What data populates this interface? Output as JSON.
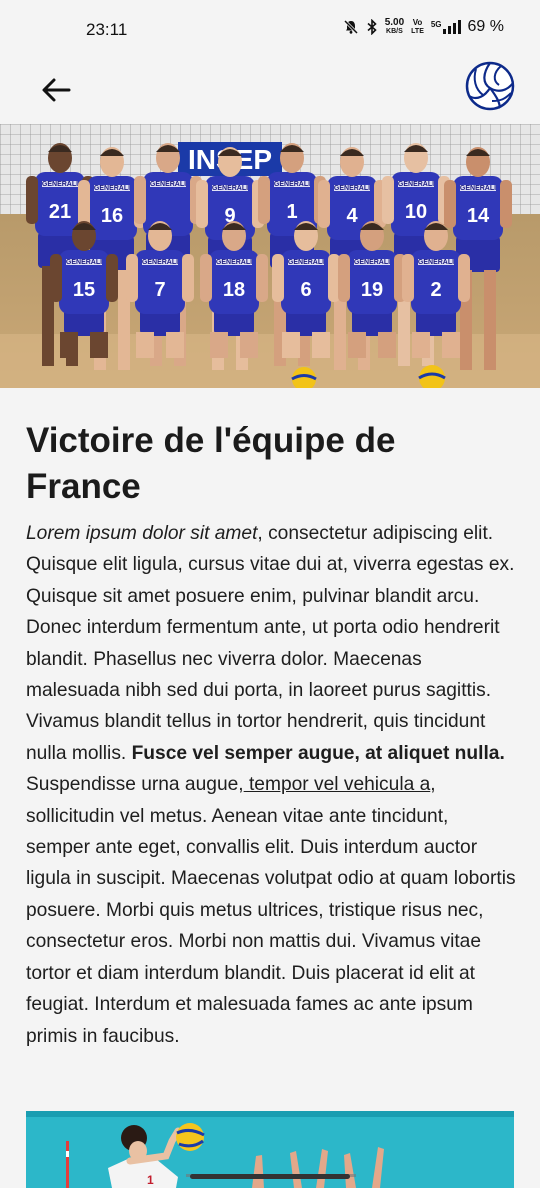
{
  "status_bar": {
    "time": "23:11",
    "net_speed_value": "5.00",
    "net_speed_unit": "KB/S",
    "volte_top": "Vo",
    "volte_bottom": "LTE",
    "network": "5G",
    "battery": "69 %"
  },
  "app_bar": {
    "back_icon": "arrow-left-icon",
    "logo_icon": "volleyball-icon"
  },
  "hero": {
    "image": "team-photo",
    "banner_text": "INSEP",
    "jersey_brand": "GENERALI",
    "back_row_numbers": [
      "21",
      "16",
      "",
      "9",
      "1",
      "4",
      "10",
      "14"
    ],
    "front_row_numbers": [
      "15",
      "7",
      "18",
      "6",
      "19",
      "2"
    ]
  },
  "article": {
    "title": "Victoire de l'équipe de France",
    "p_italic": "Lorem ipsum dolor sit amet",
    "p_part1": ", consectetur adipiscing elit. Quisque elit ligula, cursus vitae dui at, viverra egestas ex. Quisque sit amet posuere enim, pulvinar blandit arcu. Donec interdum fermentum ante, ut porta odio hendrerit blandit. Phasellus nec viverra dolor. Maecenas malesuada nibh sed dui porta, in laoreet purus sagittis. Vivamus blandit tellus in tortor hendrerit, quis tincidunt nulla mollis. ",
    "p_bold": "Fusce vel semper augue, at aliquet nulla.",
    "p_part2": " Suspendisse urna augue,",
    "p_link": " tempor vel vehicula a",
    "p_part3": ", sollicitudin vel metus. Aenean vitae ante tincidunt, semper ante eget, convallis elit. Duis interdum auctor ligula in suscipit. Maecenas volutpat odio at quam lobortis posuere. Morbi quis metus ultrices, tristique risus nec, consectetur eros. Morbi non mattis dui. Vivamus vitae tortor et diam interdum blandit. Duis placerat id elit at feugiat. Interdum et malesuada fames ac ante ipsum primis in faucibus."
  },
  "bottom_image": {
    "image": "volleyball-match-photo"
  }
}
